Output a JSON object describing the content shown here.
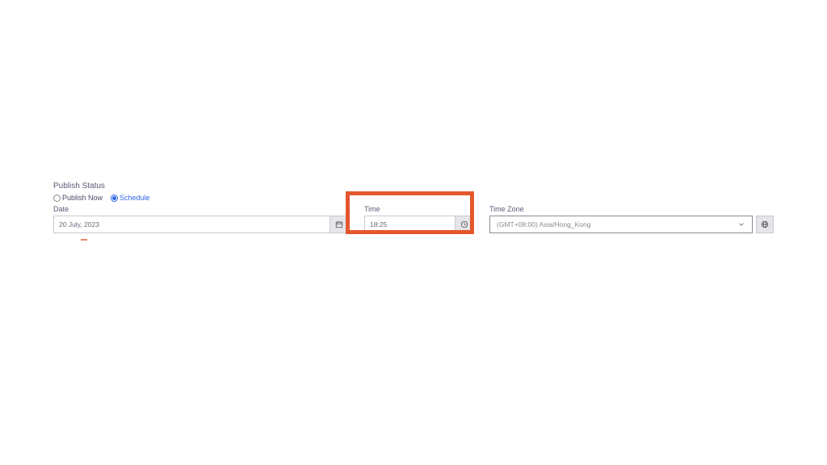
{
  "publish": {
    "section_title": "Publish Status",
    "radios": {
      "publish_now": "Publish Now",
      "schedule": "Schedule"
    }
  },
  "date": {
    "label": "Date",
    "value": "20 July, 2023"
  },
  "time": {
    "label": "Time",
    "value": "18:25"
  },
  "timezone": {
    "label": "Time Zone",
    "selected": "(GMT+08:00) Asia/Hong_Kong"
  }
}
